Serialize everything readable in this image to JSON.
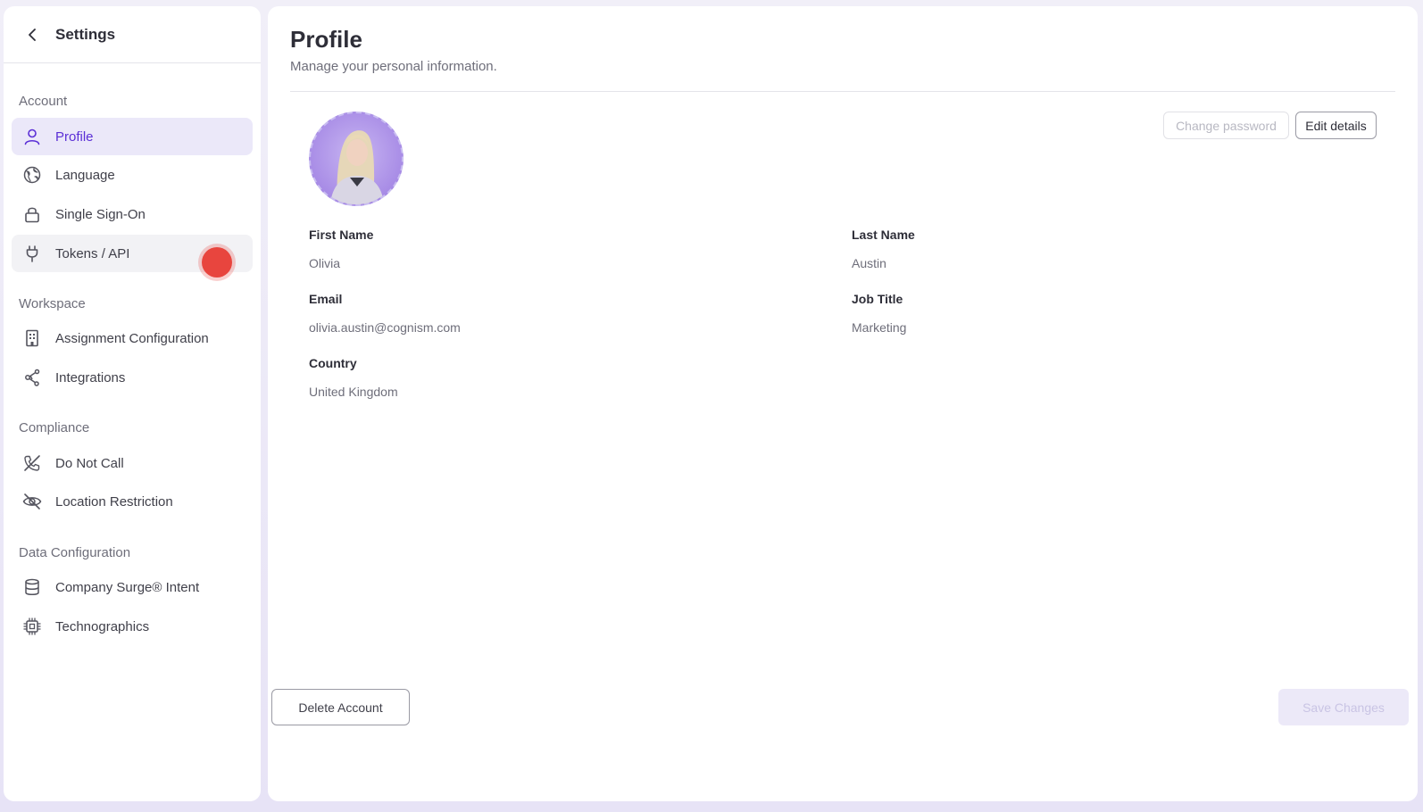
{
  "sidebar": {
    "title": "Settings",
    "sections": [
      {
        "label": "Account"
      },
      {
        "label": "Workspace"
      },
      {
        "label": "Compliance"
      },
      {
        "label": "Data Configuration"
      }
    ],
    "items": [
      {
        "label": "Profile",
        "icon": "user-icon",
        "active": true
      },
      {
        "label": "Language",
        "icon": "globe-icon"
      },
      {
        "label": "Single Sign-On",
        "icon": "lock-icon"
      },
      {
        "label": "Tokens / API",
        "icon": "plug-icon"
      },
      {
        "label": "Assignment Configuration",
        "icon": "building-icon"
      },
      {
        "label": "Integrations",
        "icon": "share-icon"
      },
      {
        "label": "Do Not Call",
        "icon": "phone-off-icon"
      },
      {
        "label": "Location Restriction",
        "icon": "eye-off-icon"
      },
      {
        "label": "Company Surge® Intent",
        "icon": "database-icon"
      },
      {
        "label": "Technographics",
        "icon": "chip-icon"
      }
    ]
  },
  "main": {
    "title": "Profile",
    "subtitle": "Manage your personal information.",
    "buttons": {
      "change_password": "Change password",
      "edit_details": "Edit details",
      "delete_account": "Delete Account",
      "save_changes": "Save Changes"
    },
    "fields": {
      "first_name": {
        "label": "First Name",
        "value": "Olivia"
      },
      "last_name": {
        "label": "Last Name",
        "value": "Austin"
      },
      "email": {
        "label": "Email",
        "value": "olivia.austin@cognism.com"
      },
      "job_title": {
        "label": "Job Title",
        "value": "Marketing"
      },
      "country": {
        "label": "Country",
        "value": "United Kingdom"
      }
    }
  },
  "colors": {
    "accent": "#5b2fd6",
    "active_bg": "#ebe8f9",
    "cursor_dot": "#e8453e"
  }
}
